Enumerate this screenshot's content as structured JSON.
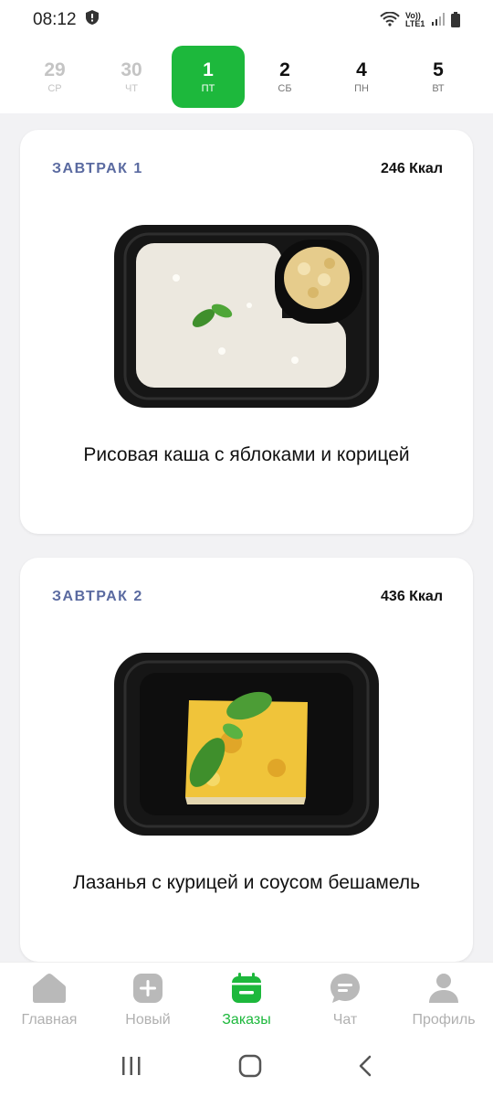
{
  "status": {
    "time": "08:12",
    "network_label": "Vo)) LTE1"
  },
  "dates": [
    {
      "num": "29",
      "day": "СР",
      "state": "past"
    },
    {
      "num": "30",
      "day": "ЧТ",
      "state": "past"
    },
    {
      "num": "1",
      "day": "ПТ",
      "state": "active"
    },
    {
      "num": "2",
      "day": "СБ",
      "state": "future"
    },
    {
      "num": "4",
      "day": "ПН",
      "state": "future"
    },
    {
      "num": "5",
      "day": "ВТ",
      "state": "future"
    }
  ],
  "meals": [
    {
      "label": "ЗАВТРАК 1",
      "kcal": "246 Ккал",
      "title": "Рисовая каша с яблоками и корицей"
    },
    {
      "label": "ЗАВТРАК 2",
      "kcal": "436 Ккал",
      "title": "Лазанья с курицей и соусом бешамель"
    }
  ],
  "nav": [
    {
      "label": "Главная",
      "icon": "home-icon"
    },
    {
      "label": "Новый",
      "icon": "plus-icon"
    },
    {
      "label": "Заказы",
      "icon": "calendar-icon"
    },
    {
      "label": "Чат",
      "icon": "chat-icon"
    },
    {
      "label": "Профиль",
      "icon": "profile-icon"
    }
  ],
  "colors": {
    "accent": "#1db83c",
    "label_blue": "#5a6aa0",
    "inactive": "#b0b0b0"
  }
}
